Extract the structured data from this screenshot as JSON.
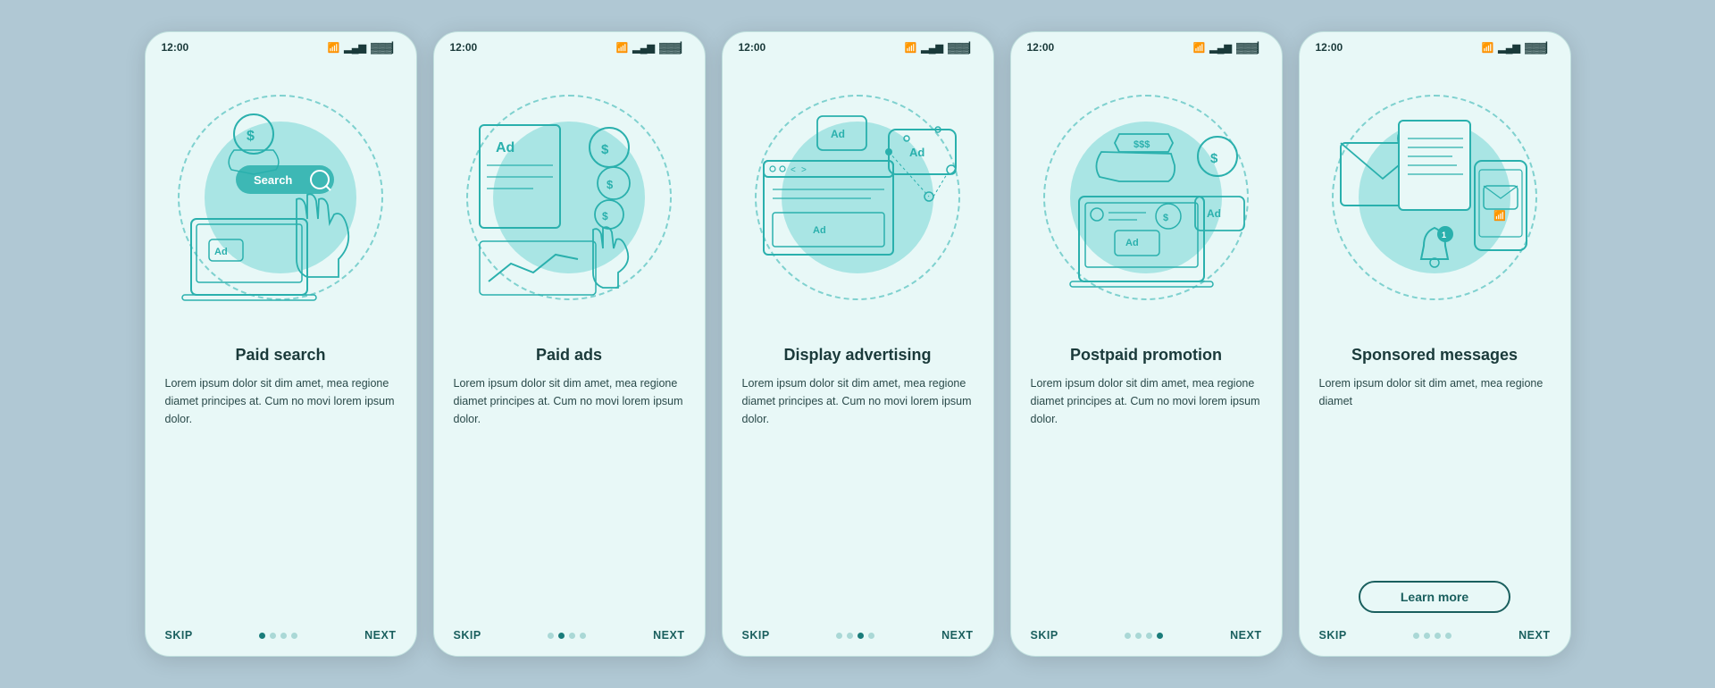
{
  "screens": [
    {
      "id": "paid-search",
      "time": "12:00",
      "title": "Paid search",
      "body": "Lorem ipsum dolor sit dim amet, mea regione diamet principes at. Cum no movi lorem ipsum dolor.",
      "dots": [
        true,
        false,
        false,
        false
      ],
      "hasLearnMore": false,
      "nav": {
        "skip": "SKIP",
        "next": "NEXT"
      }
    },
    {
      "id": "paid-ads",
      "time": "12:00",
      "title": "Paid ads",
      "body": "Lorem ipsum dolor sit dim amet, mea regione diamet principes at. Cum no movi lorem ipsum dolor.",
      "dots": [
        false,
        true,
        false,
        false
      ],
      "hasLearnMore": false,
      "nav": {
        "skip": "SKIP",
        "next": "NEXT"
      }
    },
    {
      "id": "display-advertising",
      "time": "12:00",
      "title": "Display advertising",
      "body": "Lorem ipsum dolor sit dim amet, mea regione diamet principes at. Cum no movi lorem ipsum dolor.",
      "dots": [
        false,
        false,
        true,
        false
      ],
      "hasLearnMore": false,
      "nav": {
        "skip": "SKIP",
        "next": "NEXT"
      }
    },
    {
      "id": "postpaid-promotion",
      "time": "12:00",
      "title": "Postpaid promotion",
      "body": "Lorem ipsum dolor sit dim amet, mea regione diamet principes at. Cum no movi lorem ipsum dolor.",
      "dots": [
        false,
        false,
        false,
        true
      ],
      "hasLearnMore": false,
      "nav": {
        "skip": "SKIP",
        "next": "NEXT"
      }
    },
    {
      "id": "sponsored-messages",
      "time": "12:00",
      "title": "Sponsored messages",
      "body": "Lorem ipsum dolor sit dim amet, mea regione diamet",
      "dots": [
        false,
        false,
        false,
        false
      ],
      "hasLearnMore": true,
      "learnMoreLabel": "Learn more",
      "nav": {
        "skip": "SKIP",
        "next": "NEXT"
      }
    }
  ],
  "colors": {
    "teal": "#2ab0ad",
    "darkTeal": "#1a5f5e",
    "lightBg": "#e8f8f7",
    "circleBg": "#5ecfcc"
  }
}
